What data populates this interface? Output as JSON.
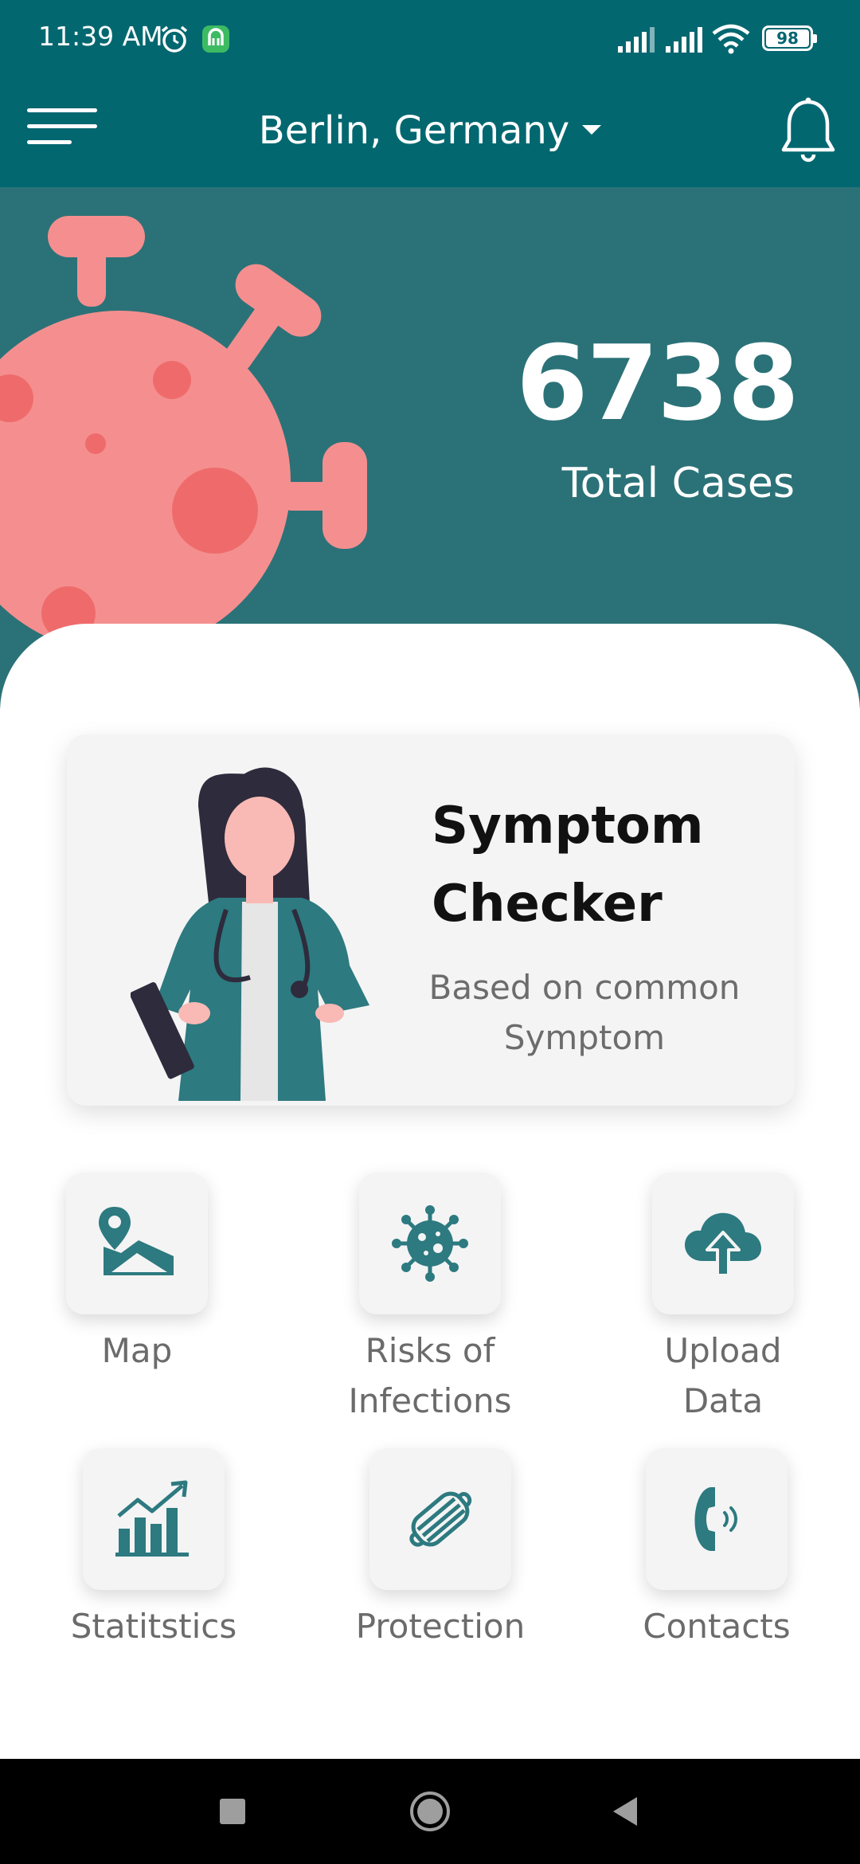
{
  "status_bar": {
    "time": "11:39 AM",
    "battery": "98",
    "icons": [
      "alarm-icon",
      "app-notification-icon",
      "signal-icon",
      "signal-icon",
      "wifi-icon",
      "battery-icon"
    ]
  },
  "app_bar": {
    "location": "Berlin, Germany",
    "icons": [
      "menu-icon",
      "dropdown-caret-icon",
      "bell-icon"
    ]
  },
  "hero": {
    "total_cases": "6738",
    "total_cases_label": "Total Cases"
  },
  "symptom_card": {
    "title_line1": "Symptom",
    "title_line2": "Checker",
    "subtitle_line1": "Based on common",
    "subtitle_line2": "Symptom"
  },
  "tiles": [
    {
      "label_line1": "Map",
      "label_line2": "",
      "icon": "map-pin-icon"
    },
    {
      "label_line1": "Risks of",
      "label_line2": "Infections",
      "icon": "virus-icon"
    },
    {
      "label_line1": "Upload",
      "label_line2": "Data",
      "icon": "cloud-upload-icon"
    },
    {
      "label_line1": "Statitstics",
      "label_line2": "",
      "icon": "chart-icon"
    },
    {
      "label_line1": "Protection",
      "label_line2": "",
      "icon": "mask-icon"
    },
    {
      "label_line1": "Contacts",
      "label_line2": "",
      "icon": "phone-icon"
    }
  ],
  "colors": {
    "primary": "#036770",
    "hero_bg": "#2b7278",
    "virus": "#f58f8f",
    "virus_spots": "#ef6b6b",
    "icon_teal": "#2d7a80",
    "card_bg": "#f4f4f4"
  },
  "nav_bar": {
    "icons": [
      "recents-square-icon",
      "home-circle-icon",
      "back-triangle-icon"
    ]
  }
}
